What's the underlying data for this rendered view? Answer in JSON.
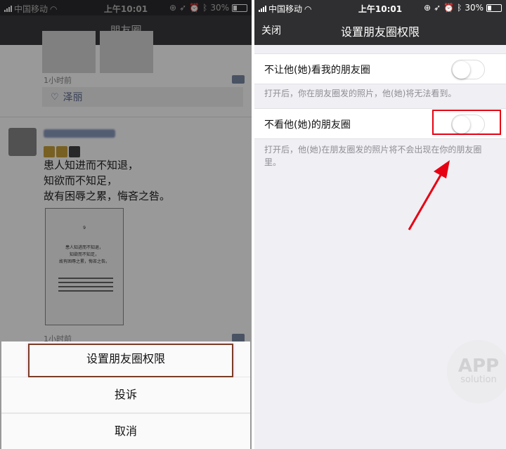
{
  "left": {
    "status": {
      "carrier": "中国移动",
      "time": "上午10:01",
      "battery": "30%"
    },
    "nav_title": "朋友圈",
    "feed": {
      "post1_time": "1小时前",
      "like_name": "泽丽",
      "post2_text": [
        "患人知进而不知退，",
        "知欲而不知足，",
        "故有困辱之累，悔吝之咎。"
      ],
      "post2_image": {
        "page_number": "9",
        "lines": [
          "患人知进而不知退，",
          "知欲而不知足，",
          "故有困辱之累，悔吝之咎。"
        ]
      },
      "post2_time": "1小时前"
    },
    "sheet": {
      "set_permission": "设置朋友圈权限",
      "report": "投诉",
      "cancel": "取消"
    }
  },
  "right": {
    "status": {
      "carrier": "中国移动",
      "time": "上午10:01",
      "battery": "30%"
    },
    "nav": {
      "close": "关闭",
      "title": "设置朋友圈权限"
    },
    "settings": [
      {
        "label": "不让他(她)看我的朋友圈",
        "on": false,
        "note": "打开后，你在朋友圈发的照片，他(她)将无法看到。"
      },
      {
        "label": "不看他(她)的朋友圈",
        "on": false,
        "note": "打开后，他(她)在朋友圈发的照片将不会出现在你的朋友圈里。"
      }
    ],
    "highlight_color": "#e60012",
    "watermark": {
      "line1": "APP",
      "line2": "solution"
    }
  }
}
